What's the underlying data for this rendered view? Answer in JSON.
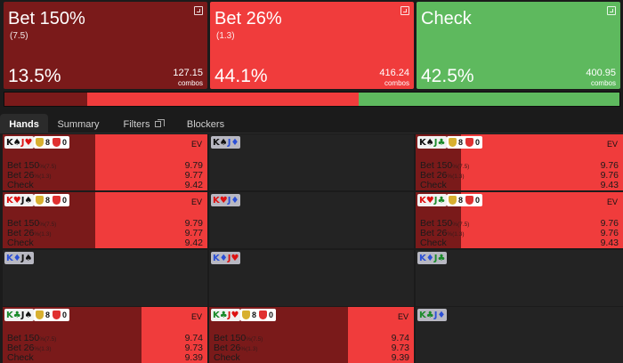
{
  "actions": [
    {
      "name": "Bet 150%",
      "sizing": "(7.5)",
      "freq": "13.5%",
      "combos": "127.15",
      "combos_unit": "combos",
      "color": "#7a1a1a"
    },
    {
      "name": "Bet 26%",
      "sizing": "(1.3)",
      "freq": "44.1%",
      "combos": "416.24",
      "combos_unit": "combos",
      "color": "#f03c3c"
    },
    {
      "name": "Check",
      "sizing": "",
      "freq": "42.5%",
      "combos": "400.95",
      "combos_unit": "combos",
      "color": "#5eb95e"
    }
  ],
  "freqbar": [
    {
      "action": "Bet 150%",
      "share": 0.135,
      "color": "#7a1a1a"
    },
    {
      "action": "Bet 26%",
      "share": 0.441,
      "color": "#f03c3c"
    },
    {
      "action": "Check",
      "share": 0.425,
      "color": "#5eb95e"
    }
  ],
  "tabs": [
    "Hands",
    "Summary",
    "Filters",
    "Blockers"
  ],
  "active_tab": "Hands",
  "ev_label": "EV",
  "hands": [
    {
      "cards": [
        {
          "rank": "K",
          "suit": "♠",
          "color": "#111"
        },
        {
          "rank": "J",
          "suit": "♥",
          "color": "#d11"
        }
      ],
      "blocked": false,
      "chips": [
        {
          "n": "8",
          "color": "#d8b030"
        },
        {
          "n": "0",
          "color": "#e03030"
        }
      ],
      "mix": [
        0.45,
        0.55,
        0.0
      ],
      "rows": [
        {
          "label": "Bet 150",
          "sub": "%(7.5)",
          "value": "9.79"
        },
        {
          "label": "Bet 26",
          "sub": "%(1.3)",
          "value": "9.77"
        },
        {
          "label": "Check",
          "sub": "",
          "value": "9.42"
        }
      ]
    },
    {
      "cards": [
        {
          "rank": "K",
          "suit": "♠",
          "color": "#111"
        },
        {
          "rank": "J",
          "suit": "♦",
          "color": "#2b4fd6"
        }
      ],
      "blocked": true,
      "chips": [],
      "mix": [
        0,
        0,
        0
      ],
      "rows": []
    },
    {
      "cards": [
        {
          "rank": "K",
          "suit": "♠",
          "color": "#111"
        },
        {
          "rank": "J",
          "suit": "♣",
          "color": "#1a8a2a"
        }
      ],
      "blocked": false,
      "chips": [
        {
          "n": "8",
          "color": "#d8b030"
        },
        {
          "n": "0",
          "color": "#e03030"
        }
      ],
      "mix": [
        0.22,
        0.78,
        0.0
      ],
      "rows": [
        {
          "label": "Bet 150",
          "sub": "%(7.5)",
          "value": "9.76"
        },
        {
          "label": "Bet 26",
          "sub": "%(1.3)",
          "value": "9.76"
        },
        {
          "label": "Check",
          "sub": "",
          "value": "9.43"
        }
      ]
    },
    {
      "cards": [
        {
          "rank": "K",
          "suit": "♥",
          "color": "#d11"
        },
        {
          "rank": "J",
          "suit": "♠",
          "color": "#111"
        }
      ],
      "blocked": false,
      "chips": [
        {
          "n": "8",
          "color": "#d8b030"
        },
        {
          "n": "0",
          "color": "#e03030"
        }
      ],
      "mix": [
        0.45,
        0.55,
        0.0
      ],
      "rows": [
        {
          "label": "Bet 150",
          "sub": "%(7.5)",
          "value": "9.79"
        },
        {
          "label": "Bet 26",
          "sub": "%(1.3)",
          "value": "9.77"
        },
        {
          "label": "Check",
          "sub": "",
          "value": "9.42"
        }
      ]
    },
    {
      "cards": [
        {
          "rank": "K",
          "suit": "♥",
          "color": "#d11"
        },
        {
          "rank": "J",
          "suit": "♦",
          "color": "#2b4fd6"
        }
      ],
      "blocked": true,
      "chips": [],
      "mix": [
        0,
        0,
        0
      ],
      "rows": []
    },
    {
      "cards": [
        {
          "rank": "K",
          "suit": "♥",
          "color": "#d11"
        },
        {
          "rank": "J",
          "suit": "♣",
          "color": "#1a8a2a"
        }
      ],
      "blocked": false,
      "chips": [
        {
          "n": "8",
          "color": "#d8b030"
        },
        {
          "n": "0",
          "color": "#e03030"
        }
      ],
      "mix": [
        0.22,
        0.78,
        0.0
      ],
      "rows": [
        {
          "label": "Bet 150",
          "sub": "%(7.5)",
          "value": "9.76"
        },
        {
          "label": "Bet 26",
          "sub": "%(1.3)",
          "value": "9.76"
        },
        {
          "label": "Check",
          "sub": "",
          "value": "9.43"
        }
      ]
    },
    {
      "cards": [
        {
          "rank": "K",
          "suit": "♦",
          "color": "#2b4fd6"
        },
        {
          "rank": "J",
          "suit": "♠",
          "color": "#111"
        }
      ],
      "blocked": true,
      "chips": [],
      "mix": [
        0,
        0,
        0
      ],
      "rows": []
    },
    {
      "cards": [
        {
          "rank": "K",
          "suit": "♦",
          "color": "#2b4fd6"
        },
        {
          "rank": "J",
          "suit": "♥",
          "color": "#d11"
        }
      ],
      "blocked": true,
      "chips": [],
      "mix": [
        0,
        0,
        0
      ],
      "rows": []
    },
    {
      "cards": [
        {
          "rank": "K",
          "suit": "♦",
          "color": "#2b4fd6"
        },
        {
          "rank": "J",
          "suit": "♣",
          "color": "#1a8a2a"
        }
      ],
      "blocked": true,
      "chips": [],
      "mix": [
        0,
        0,
        0
      ],
      "rows": []
    },
    {
      "cards": [
        {
          "rank": "K",
          "suit": "♣",
          "color": "#1a8a2a"
        },
        {
          "rank": "J",
          "suit": "♠",
          "color": "#111"
        }
      ],
      "blocked": false,
      "chips": [
        {
          "n": "8",
          "color": "#d8b030"
        },
        {
          "n": "0",
          "color": "#e03030"
        }
      ],
      "mix": [
        0.68,
        0.32,
        0.0
      ],
      "rows": [
        {
          "label": "Bet 150",
          "sub": "%(7.5)",
          "value": "9.74"
        },
        {
          "label": "Bet 26",
          "sub": "%(1.3)",
          "value": "9.73"
        },
        {
          "label": "Check",
          "sub": "",
          "value": "9.39"
        }
      ]
    },
    {
      "cards": [
        {
          "rank": "K",
          "suit": "♣",
          "color": "#1a8a2a"
        },
        {
          "rank": "J",
          "suit": "♥",
          "color": "#d11"
        }
      ],
      "blocked": false,
      "chips": [
        {
          "n": "8",
          "color": "#d8b030"
        },
        {
          "n": "0",
          "color": "#e03030"
        }
      ],
      "mix": [
        0.68,
        0.32,
        0.0
      ],
      "rows": [
        {
          "label": "Bet 150",
          "sub": "%(7.5)",
          "value": "9.74"
        },
        {
          "label": "Bet 26",
          "sub": "%(1.3)",
          "value": "9.73"
        },
        {
          "label": "Check",
          "sub": "",
          "value": "9.39"
        }
      ]
    },
    {
      "cards": [
        {
          "rank": "K",
          "suit": "♣",
          "color": "#1a8a2a"
        },
        {
          "rank": "J",
          "suit": "♦",
          "color": "#2b4fd6"
        }
      ],
      "blocked": true,
      "chips": [],
      "mix": [
        0,
        0,
        0
      ],
      "rows": []
    }
  ]
}
